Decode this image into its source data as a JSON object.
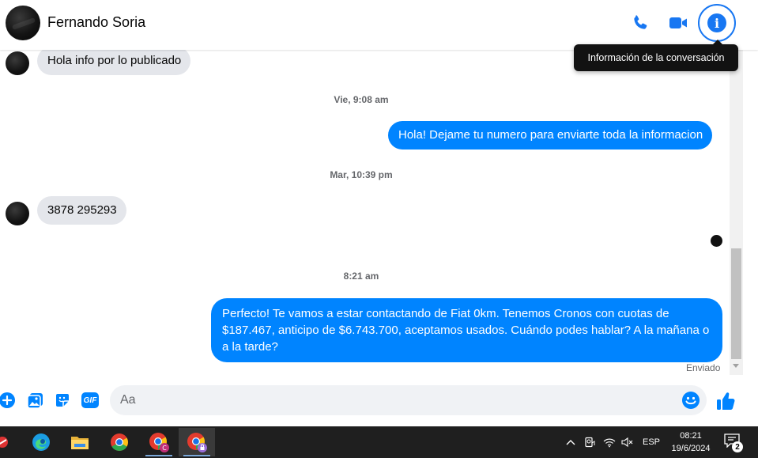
{
  "header": {
    "contact_name": "Fernando Soria",
    "tooltip": "Información de la conversación"
  },
  "messages": {
    "msg1": "Hola info por lo publicado",
    "ts1": "Vie, 9:08 am",
    "msg2": "Hola! Dejame tu numero para enviarte toda la informacion",
    "ts2": "Mar, 10:39 pm",
    "msg3": "3878 295293",
    "ts3": "8:21 am",
    "msg4_lines": [
      "Perfecto! Te vamos a estar contactando de Fiat 0km. Tenemos Cronos con cuotas de",
      "$187.467, anticipo de $6.743.700, aceptamos usados. Cuándo podes hablar? A la mañana o",
      "a la tarde?"
    ],
    "status": "Enviado"
  },
  "composer": {
    "placeholder": "Aa",
    "gif_label": "GIF"
  },
  "taskbar": {
    "language": "ESP",
    "time": "08:21",
    "date": "19/6/2024",
    "notification_count": "2"
  },
  "colors": {
    "accent": "#0084ff",
    "messenger_blue": "#1877f2",
    "incoming_bubble": "#e4e6eb"
  }
}
